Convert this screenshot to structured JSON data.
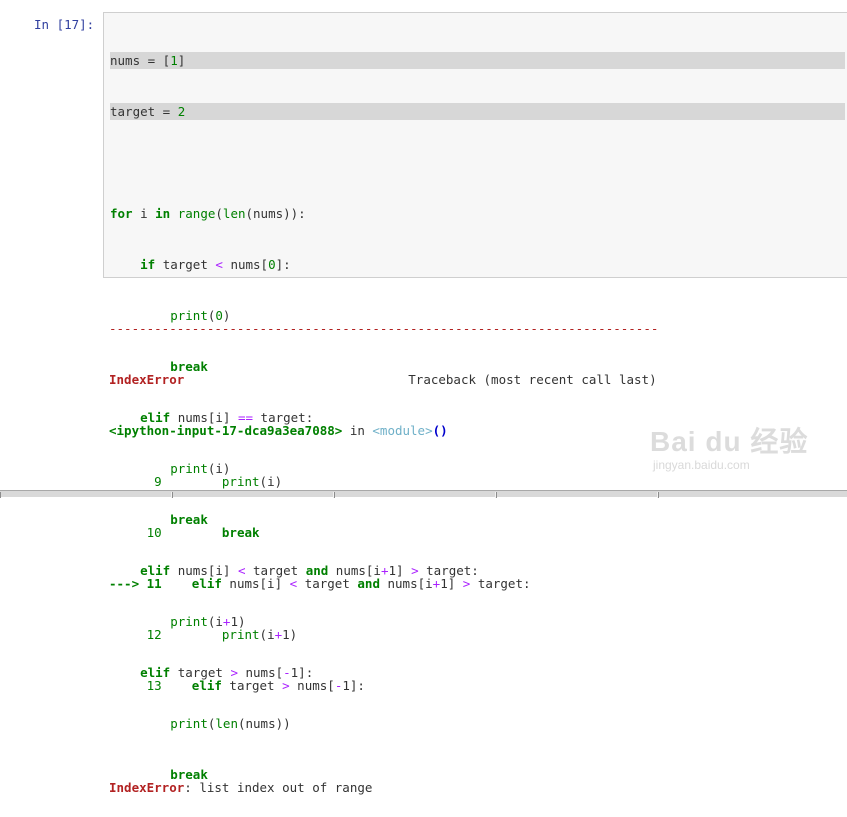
{
  "cell": {
    "prompt": "In  [17]:",
    "lines": [
      "nums = [1]",
      "target = 2",
      "",
      "for i in range(len(nums)):",
      "    if target < nums[0]:",
      "        print(0)",
      "        break",
      "    elif nums[i] == target:",
      "        print(i)",
      "        break",
      "    elif nums[i] < target and nums[i+1] > target:",
      "        print(i+1)",
      "    elif target > nums[-1]:",
      "        print(len(nums))",
      "        break"
    ]
  },
  "output": {
    "separator": "-------------------------------------------------------------------------",
    "error_name": "IndexError",
    "traceback_header": "Traceback (most recent call last)",
    "input_ref": "<ipython-input-17-dca9a3ea7088>",
    "in_word": " in ",
    "module": "<module>",
    "call": "()",
    "trace_lines": [
      {
        "marker": "      9",
        "code": "        print(i)"
      },
      {
        "marker": "     10",
        "code": "        break"
      },
      {
        "marker": "---> 11",
        "code": "    elif nums[i] < target and nums[i+1] > target:"
      },
      {
        "marker": "     12",
        "code": "        print(i+1)"
      },
      {
        "marker": "     13",
        "code": "    elif target > nums[-1]:"
      }
    ],
    "final_error_name": "IndexError",
    "final_message": ": list index out of range"
  },
  "watermark": {
    "logo": "Bai du 经验",
    "url": "jingyan.baidu.com"
  }
}
